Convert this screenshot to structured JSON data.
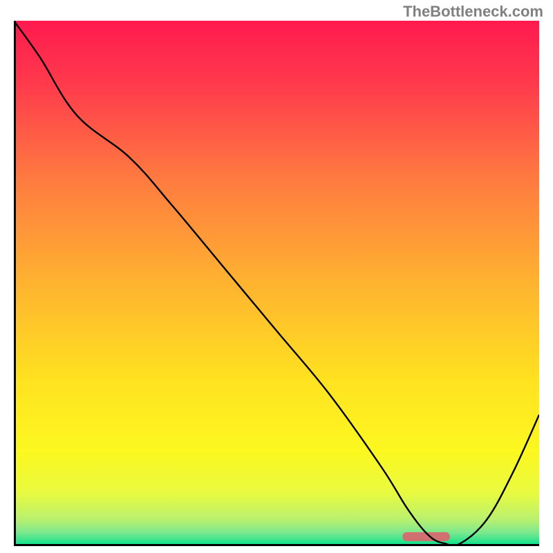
{
  "watermark": "TheBottleneck.com",
  "chart_data": {
    "type": "line",
    "title": "",
    "xlabel": "",
    "ylabel": "",
    "xlim": [
      0,
      100
    ],
    "ylim": [
      0,
      100
    ],
    "background": {
      "type": "vertical-gradient",
      "stops": [
        {
          "pos": 0.0,
          "color": "#ff1a4e"
        },
        {
          "pos": 0.12,
          "color": "#ff3a4c"
        },
        {
          "pos": 0.3,
          "color": "#ff7a40"
        },
        {
          "pos": 0.5,
          "color": "#ffb330"
        },
        {
          "pos": 0.68,
          "color": "#ffe120"
        },
        {
          "pos": 0.82,
          "color": "#fcf820"
        },
        {
          "pos": 0.9,
          "color": "#e8fa40"
        },
        {
          "pos": 0.95,
          "color": "#b8f070"
        },
        {
          "pos": 0.975,
          "color": "#7ae88f"
        },
        {
          "pos": 1.0,
          "color": "#00e08a"
        }
      ]
    },
    "series": [
      {
        "name": "bottleneck-curve",
        "color": "#000000",
        "x": [
          0,
          5,
          12,
          22,
          30,
          40,
          50,
          60,
          70,
          75,
          79,
          82,
          85,
          90,
          95,
          100
        ],
        "y": [
          100,
          93,
          82,
          74,
          65,
          53,
          41,
          29,
          15,
          7,
          2,
          0.5,
          0.5,
          5,
          14,
          25
        ]
      }
    ],
    "marker": {
      "x_start": 74,
      "x_end": 83,
      "y": 1.8,
      "color": "#d07070"
    }
  }
}
